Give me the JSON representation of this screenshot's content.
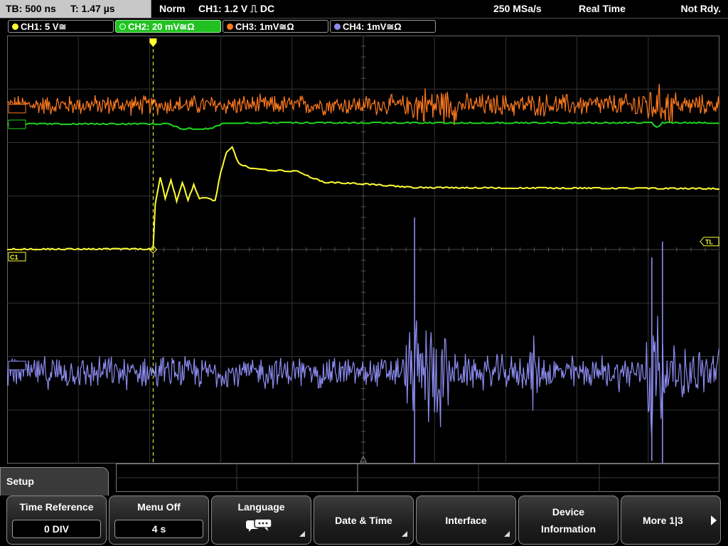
{
  "status_bar": {
    "timebase": "TB: 500 ns",
    "trigger_time": "T: 1.47 µs",
    "trigger_mode": "Norm",
    "trigger_source": "CH1: 1.2 V ⎍ DC",
    "sample_rate": "250 MSa/s",
    "acquisition_mode": "Real Time",
    "status": "Not Rdy."
  },
  "channels": [
    {
      "label": "CH1: 5 V≅",
      "color": "#ffff33",
      "active": false
    },
    {
      "label": "CH2: 20 mV≅Ω",
      "color": "#1ed81e",
      "active": true
    },
    {
      "label": "CH3: 1mV≅Ω",
      "color": "#ff7a1f",
      "active": false
    },
    {
      "label": "CH4: 1mV≅Ω",
      "color": "#8c8cf0",
      "active": false
    }
  ],
  "markers": {
    "tl": "TL",
    "c1": "C1"
  },
  "menu": {
    "title": "Setup",
    "time_reference": {
      "label": "Time Reference",
      "value": "0 DIV"
    },
    "menu_off": {
      "label": "Menu Off",
      "value": "4 s"
    },
    "language": {
      "label": "Language",
      "icon": "speech-bubbles-icon"
    },
    "date_time": {
      "label": "Date & Time"
    },
    "interface": {
      "label": "Interface"
    },
    "device_information": {
      "label_line1": "Device",
      "label_line2": "Information"
    },
    "more": {
      "label": "More 1|3"
    }
  },
  "chart_data": {
    "type": "line",
    "grid": {
      "x_divisions": 10,
      "y_divisions": 8,
      "visible": true
    },
    "xlabel": "",
    "ylabel": "",
    "title": "",
    "trigger_position_div": 2.05,
    "x_range_div": [
      0,
      10
    ],
    "y_range_div": [
      0,
      8
    ],
    "series": [
      {
        "channel": "CH3",
        "color": "#ff7a1f",
        "generator": "noise",
        "baseline_div": 6.7,
        "segments": [
          {
            "x_from": 0,
            "x_to": 5.65,
            "amplitude_div": 0.22
          },
          {
            "x_from": 5.65,
            "x_to": 6.3,
            "amplitude_div": 0.42
          },
          {
            "x_from": 6.3,
            "x_to": 8.8,
            "amplitude_div": 0.25
          },
          {
            "x_from": 8.8,
            "x_to": 9.4,
            "amplitude_div": 0.45
          },
          {
            "x_from": 9.4,
            "x_to": 10,
            "amplitude_div": 0.22
          }
        ]
      },
      {
        "channel": "CH2",
        "color": "#1ed81e",
        "generator": "steps",
        "points": [
          [
            0,
            6.34
          ],
          [
            2.25,
            6.34
          ],
          [
            2.45,
            6.25
          ],
          [
            2.85,
            6.25
          ],
          [
            2.95,
            6.3
          ],
          [
            3.05,
            6.36
          ],
          [
            9.05,
            6.36
          ],
          [
            9.12,
            6.27
          ],
          [
            9.2,
            6.36
          ],
          [
            10,
            6.36
          ]
        ]
      },
      {
        "channel": "CH1",
        "color": "#ffff33",
        "generator": "steps",
        "points": [
          [
            0,
            4.0
          ],
          [
            2.05,
            4.0
          ],
          [
            2.08,
            4.85
          ],
          [
            2.15,
            5.35
          ],
          [
            2.22,
            4.95
          ],
          [
            2.3,
            5.3
          ],
          [
            2.38,
            4.9
          ],
          [
            2.46,
            5.25
          ],
          [
            2.54,
            4.92
          ],
          [
            2.62,
            5.2
          ],
          [
            2.7,
            4.95
          ],
          [
            2.8,
            4.95
          ],
          [
            2.92,
            4.9
          ],
          [
            3.0,
            5.45
          ],
          [
            3.08,
            5.8
          ],
          [
            3.16,
            5.9
          ],
          [
            3.25,
            5.6
          ],
          [
            3.35,
            5.55
          ],
          [
            3.45,
            5.5
          ],
          [
            3.6,
            5.48
          ],
          [
            4.1,
            5.45
          ],
          [
            4.25,
            5.35
          ],
          [
            4.45,
            5.25
          ],
          [
            5.0,
            5.22
          ],
          [
            5.7,
            5.15
          ],
          [
            10,
            5.13
          ]
        ]
      },
      {
        "channel": "CH4",
        "color": "#8c8cf0",
        "generator": "noise",
        "baseline_div": 1.7,
        "segments": [
          {
            "x_from": 0,
            "x_to": 5.6,
            "amplitude_div": 0.35
          },
          {
            "x_from": 5.6,
            "x_to": 6.2,
            "amplitude_div": 1.25
          },
          {
            "x_from": 6.2,
            "x_to": 7.3,
            "amplitude_div": 0.38
          },
          {
            "x_from": 7.3,
            "x_to": 7.45,
            "amplitude_div": 0.8
          },
          {
            "x_from": 7.45,
            "x_to": 8.95,
            "amplitude_div": 0.38
          },
          {
            "x_from": 8.95,
            "x_to": 9.25,
            "amplitude_div": 1.6
          },
          {
            "x_from": 9.25,
            "x_to": 10,
            "amplitude_div": 0.55
          }
        ],
        "spikes": [
          {
            "x": 5.72,
            "top_div": 4.6,
            "bottom_div": 0.0
          },
          {
            "x": 9.05,
            "top_div": 3.85,
            "bottom_div": 0.05
          },
          {
            "x": 9.2,
            "top_div": 4.15,
            "bottom_div": 0.0
          }
        ]
      }
    ]
  }
}
